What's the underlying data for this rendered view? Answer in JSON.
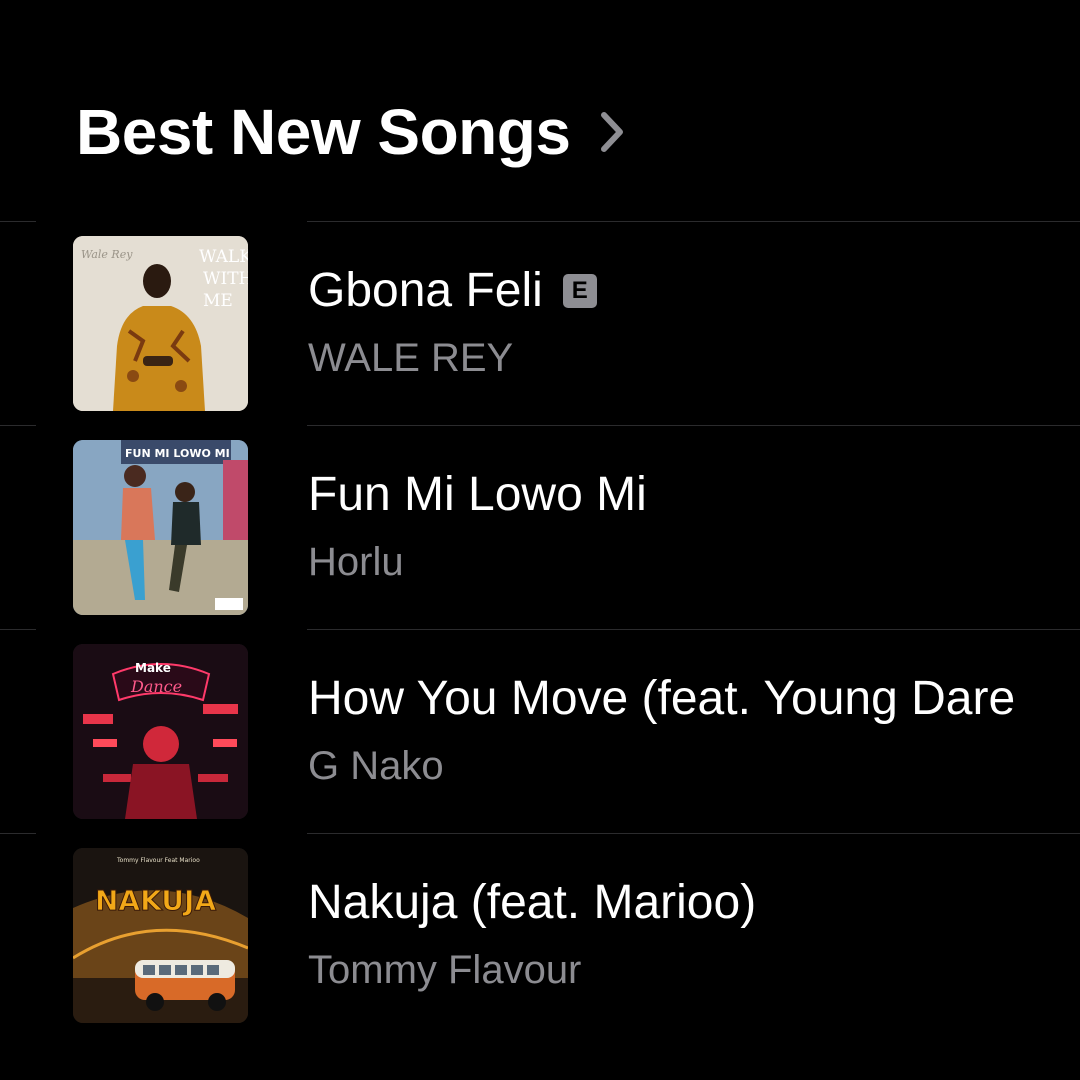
{
  "header": {
    "title": "Best New Songs",
    "chevron_icon": "chevron-right-icon"
  },
  "colors": {
    "background": "#000000",
    "title": "#ffffff",
    "secondary_text": "#8c8c91",
    "separator": "#2b2b2d",
    "explicit_badge": "#8e8e93"
  },
  "songs": [
    {
      "title": "Gbona Feli",
      "artist": "WALE REY",
      "explicit": true,
      "explicit_label": "E",
      "artwork_text": [
        "Wale Rey",
        "WALK",
        "WITH",
        "ME"
      ]
    },
    {
      "title": "Fun Mi Lowo Mi",
      "artist": "Horlu",
      "explicit": false,
      "artwork_text": [
        "FUN MI LOWO MI"
      ]
    },
    {
      "title": "How You Move (feat. Young Dare",
      "artist": "G Nako",
      "explicit": false,
      "artwork_text": [
        "Make",
        "Dance"
      ]
    },
    {
      "title": "Nakuja (feat. Marioo)",
      "artist": "Tommy Flavour",
      "explicit": false,
      "artwork_text": [
        "Tommy Flavour Feat Marioo",
        "NAKUJA"
      ]
    }
  ]
}
